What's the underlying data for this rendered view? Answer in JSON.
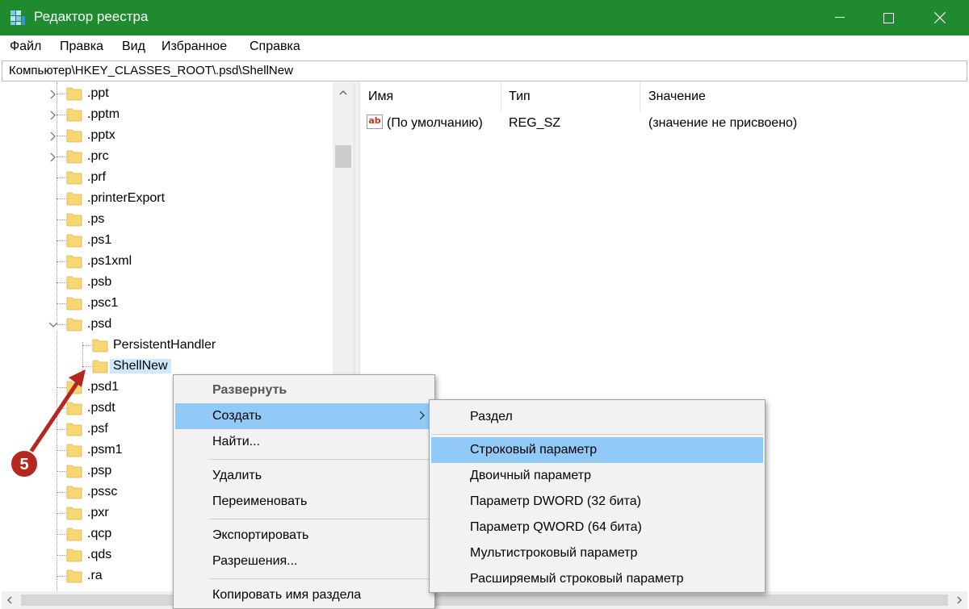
{
  "window": {
    "title": "Редактор реестра",
    "title_color": "#1f8b2e"
  },
  "menu": [
    "Файл",
    "Правка",
    "Вид",
    "Избранное",
    "Справка"
  ],
  "address": "Компьютер\\HKEY_CLASSES_ROOT\\.psd\\ShellNew",
  "tree": {
    "items": [
      {
        "label": ".ppt",
        "expander": "collapsed"
      },
      {
        "label": ".pptm",
        "expander": "collapsed"
      },
      {
        "label": ".pptx",
        "expander": "collapsed"
      },
      {
        "label": ".prc",
        "expander": "collapsed"
      },
      {
        "label": ".prf",
        "expander": "none"
      },
      {
        "label": ".printerExport",
        "expander": "none"
      },
      {
        "label": ".ps",
        "expander": "none"
      },
      {
        "label": ".ps1",
        "expander": "none"
      },
      {
        "label": ".ps1xml",
        "expander": "none"
      },
      {
        "label": ".psb",
        "expander": "none"
      },
      {
        "label": ".psc1",
        "expander": "none"
      },
      {
        "label": ".psd",
        "expander": "expanded"
      },
      {
        "label": "PersistentHandler",
        "expander": "none",
        "child": true
      },
      {
        "label": "ShellNew",
        "expander": "none",
        "child": true,
        "selected": true
      },
      {
        "label": ".psd1",
        "expander": "none"
      },
      {
        "label": ".psdt",
        "expander": "none"
      },
      {
        "label": ".psf",
        "expander": "none"
      },
      {
        "label": ".psm1",
        "expander": "none"
      },
      {
        "label": ".psp",
        "expander": "none"
      },
      {
        "label": ".pssc",
        "expander": "none"
      },
      {
        "label": ".pxr",
        "expander": "none"
      },
      {
        "label": ".qcp",
        "expander": "none"
      },
      {
        "label": ".qds",
        "expander": "none"
      },
      {
        "label": ".ra",
        "expander": "none"
      }
    ]
  },
  "values": {
    "columns": [
      "Имя",
      "Тип",
      "Значение"
    ],
    "rows": [
      {
        "name": "(По умолчанию)",
        "type": "REG_SZ",
        "value": "(значение не присвоено)",
        "icon": "ab"
      }
    ]
  },
  "context_menu": {
    "items": [
      "Развернуть",
      "Создать",
      "Найти...",
      "Удалить",
      "Переименовать",
      "Экспортировать",
      "Разрешения...",
      "Копировать имя раздела"
    ]
  },
  "submenu": {
    "items": [
      "Раздел",
      "Строковый параметр",
      "Двоичный параметр",
      "Параметр DWORD (32 бита)",
      "Параметр QWORD (64 бита)",
      "Мультистроковый параметр",
      "Расширяемый строковый параметр"
    ]
  },
  "annotation": {
    "step": "5",
    "color": "#b5281f"
  },
  "colors": {
    "highlight": "#91c9f7",
    "selection": "#cde8ff",
    "folder": "#f7d774"
  }
}
